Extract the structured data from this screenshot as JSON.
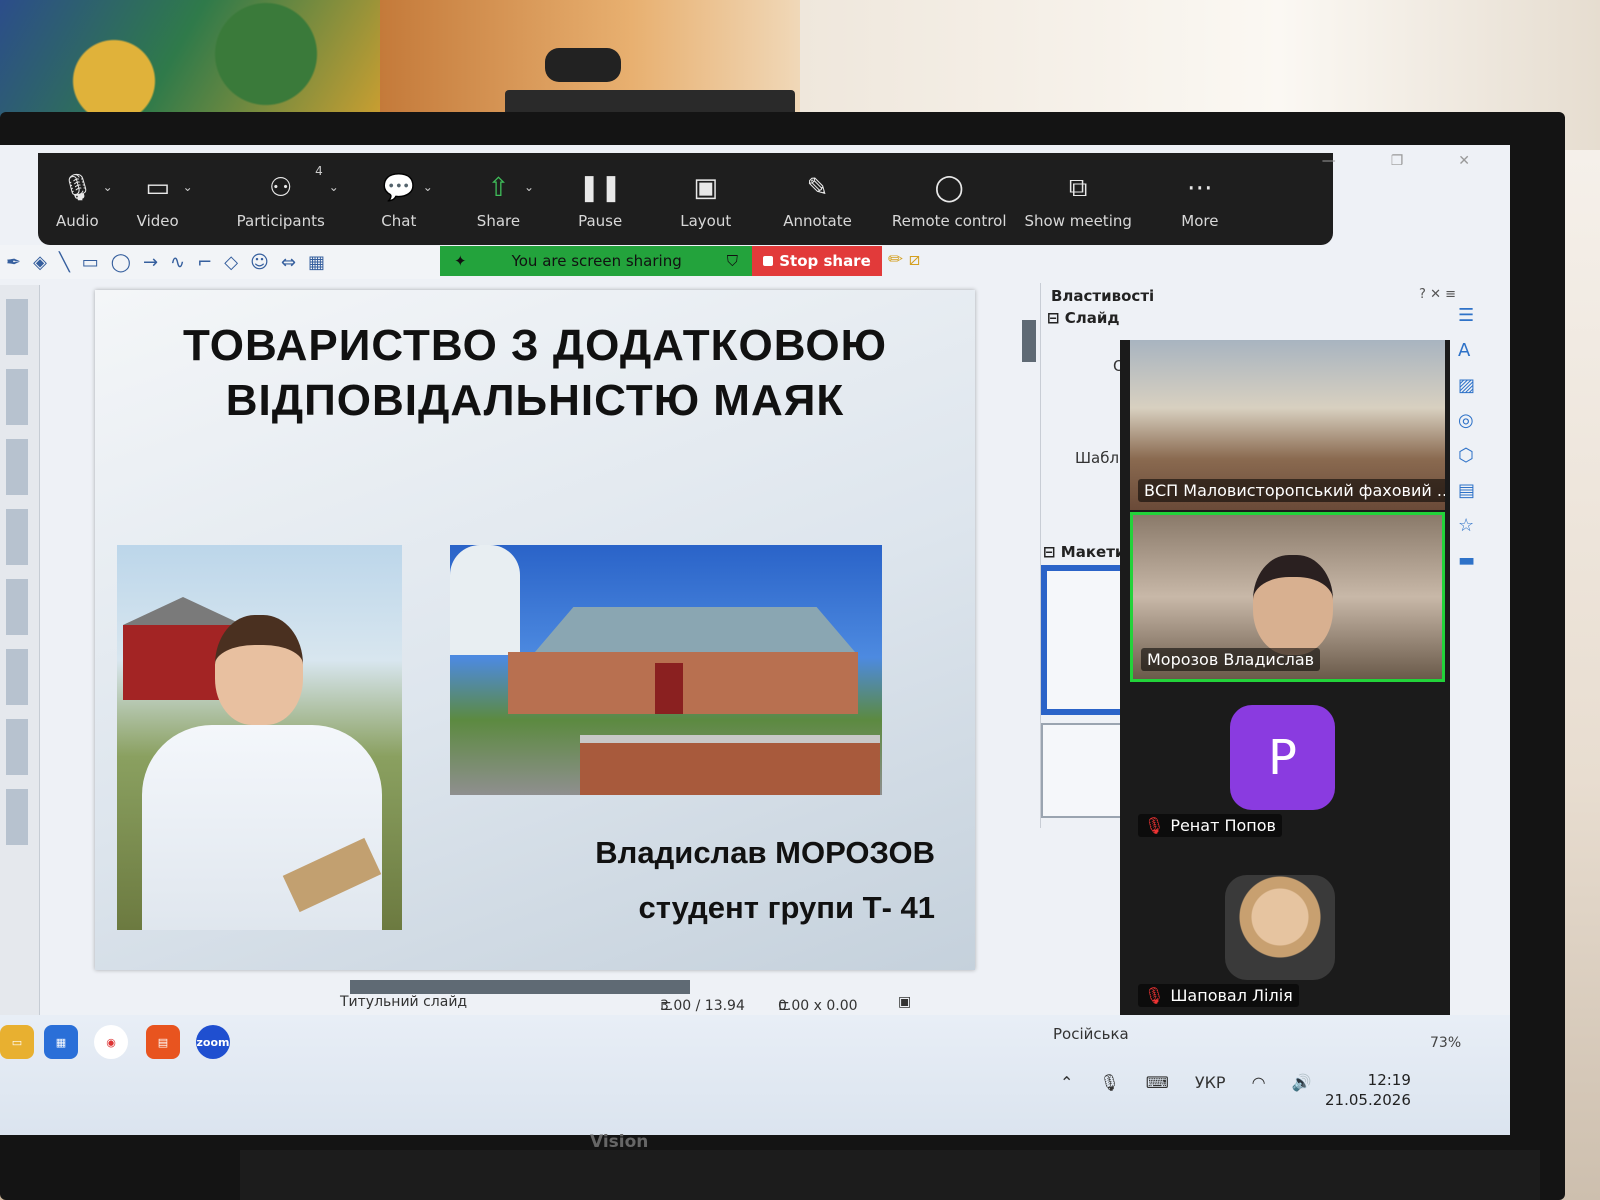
{
  "zoom_toolbar": {
    "items": [
      {
        "label": "Audio",
        "icon": "microphone-icon"
      },
      {
        "label": "Video",
        "icon": "video-camera-icon"
      },
      {
        "label": "Participants",
        "icon": "participants-icon",
        "count": "4"
      },
      {
        "label": "Chat",
        "icon": "chat-bubble-icon"
      },
      {
        "label": "Share",
        "icon": "share-screen-icon"
      },
      {
        "label": "Pause",
        "icon": "pause-icon"
      },
      {
        "label": "Layout",
        "icon": "layout-icon"
      },
      {
        "label": "Annotate",
        "icon": "pencil-icon"
      },
      {
        "label": "Remote control",
        "icon": "mouse-icon"
      },
      {
        "label": "Show meeting",
        "icon": "show-meeting-icon"
      },
      {
        "label": "More",
        "icon": "more-dots-icon"
      }
    ],
    "sharing_status": "You are screen sharing",
    "stop_share_label": "Stop share"
  },
  "slide": {
    "title": "ТОВАРИСТВО З ДОДАТКОВОЮ ВІДПОВІДАЛЬНІСТЮ МАЯК",
    "author": "Владислав МОРОЗОВ",
    "group": "студент групи Т- 41"
  },
  "properties_panel": {
    "title": "Властивості",
    "section_slide": "Слайд",
    "field_or": "Ор",
    "field_template": "Шаблон",
    "section_layouts": "Макети"
  },
  "gallery": {
    "participants": [
      {
        "name": "ВСП Маловисторопський фаховий ...",
        "muted": false
      },
      {
        "name": "Морозов Владислав",
        "muted": false,
        "active_speaker": true
      },
      {
        "name": "Ренат Попов",
        "muted": true,
        "avatar_letter": "P"
      },
      {
        "name": "Шаповал Лілія",
        "muted": true
      }
    ]
  },
  "status_bar": {
    "slide_name": "Титульний слайд",
    "position": "3.00 / 13.94",
    "size": "0.00 x 0.00",
    "language": "Російська",
    "zoom": "73%"
  },
  "taskbar": {
    "apps": [
      "File Explorer",
      "Microsoft Store",
      "Chrome",
      "Impress",
      "zoom"
    ],
    "keyboard_lang": "УКР",
    "time": "12:19",
    "date": "21.05.2026"
  },
  "monitor_brand": "Vision",
  "colors": {
    "share_green": "#23a33c",
    "stop_red": "#e23a3a",
    "active_speaker_border": "#22d33a",
    "avatar_purple": "#8a3be0"
  }
}
